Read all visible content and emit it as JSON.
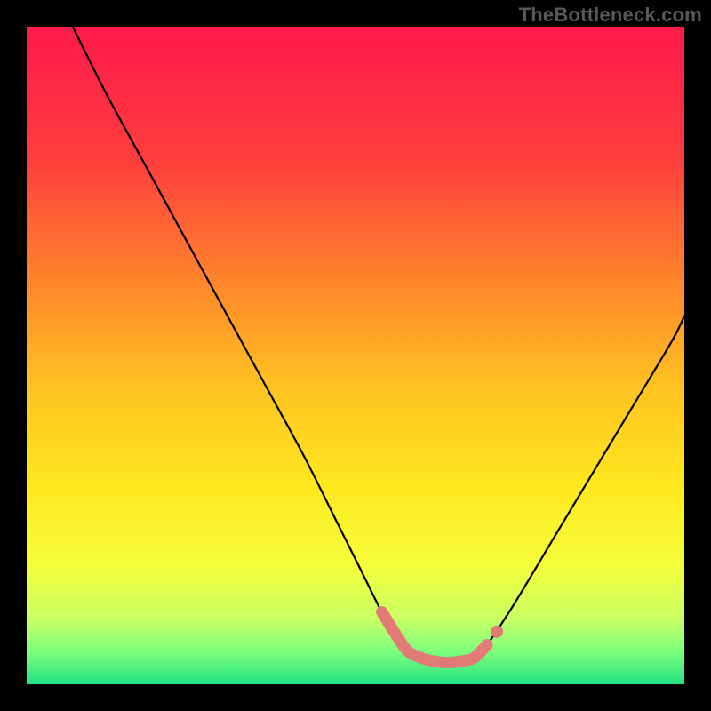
{
  "watermark": "TheBottleneck.com",
  "chart_data": {
    "type": "line",
    "title": "",
    "xlabel": "",
    "ylabel": "",
    "xlim": [
      0,
      100
    ],
    "ylim": [
      0,
      100
    ],
    "gradient_stops": [
      {
        "offset": 0.0,
        "color": "#ff1a4b"
      },
      {
        "offset": 0.2,
        "color": "#ff3d3d"
      },
      {
        "offset": 0.4,
        "color": "#ff8a2a"
      },
      {
        "offset": 0.55,
        "color": "#ffc321"
      },
      {
        "offset": 0.7,
        "color": "#ffe81e"
      },
      {
        "offset": 0.82,
        "color": "#f4ff3a"
      },
      {
        "offset": 0.9,
        "color": "#c9ff63"
      },
      {
        "offset": 0.95,
        "color": "#7dff7d"
      },
      {
        "offset": 1.0,
        "color": "#22e183"
      }
    ],
    "series": [
      {
        "name": "bottleneck-curve",
        "x": [
          7,
          12,
          18,
          24,
          30,
          36,
          42,
          47,
          51,
          54,
          56.5,
          58,
          60,
          62,
          64,
          66,
          68,
          70,
          74,
          80,
          86,
          92,
          98,
          100
        ],
        "y": [
          100,
          90,
          79,
          68,
          57,
          46,
          35,
          25,
          17,
          11,
          7,
          5,
          4,
          3.5,
          3.3,
          3.5,
          4,
          6,
          12,
          22,
          32,
          42,
          52,
          56
        ]
      }
    ],
    "highlight_segment": {
      "name": "near-zero-band",
      "color": "#e27a78",
      "x": [
        54,
        56.5,
        58,
        60,
        62,
        64,
        66,
        68,
        70
      ],
      "y": [
        11,
        7,
        5,
        4,
        3.5,
        3.3,
        3.5,
        4,
        6
      ]
    },
    "highlight_dot": {
      "x": 71.5,
      "y": 8,
      "color": "#e27a78"
    }
  }
}
